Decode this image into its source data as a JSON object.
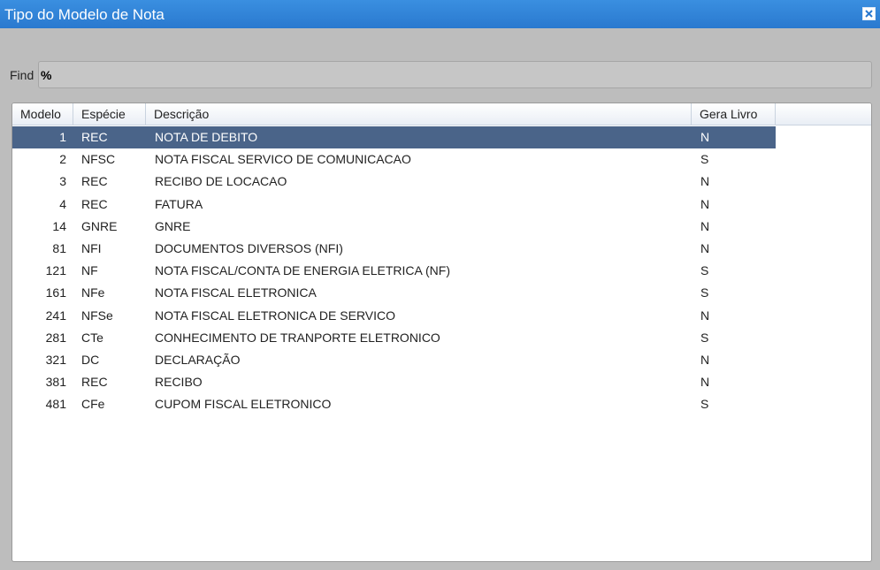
{
  "window": {
    "title": "Tipo do Modelo de Nota"
  },
  "find": {
    "label": "Find",
    "value": "%"
  },
  "table": {
    "columns": [
      "Modelo",
      "Espécie",
      "Descrição",
      "Gera Livro"
    ],
    "selected_row": 0,
    "rows": [
      {
        "modelo": "1",
        "especie": "REC",
        "descricao": "NOTA DE DEBITO",
        "gera_livro": "N"
      },
      {
        "modelo": "2",
        "especie": "NFSC",
        "descricao": "NOTA FISCAL SERVICO DE COMUNICACAO",
        "gera_livro": "S"
      },
      {
        "modelo": "3",
        "especie": "REC",
        "descricao": "RECIBO DE LOCACAO",
        "gera_livro": "N"
      },
      {
        "modelo": "4",
        "especie": "REC",
        "descricao": "FATURA",
        "gera_livro": "N"
      },
      {
        "modelo": "14",
        "especie": "GNRE",
        "descricao": "GNRE",
        "gera_livro": "N"
      },
      {
        "modelo": "81",
        "especie": "NFI",
        "descricao": "DOCUMENTOS DIVERSOS (NFI)",
        "gera_livro": "N"
      },
      {
        "modelo": "121",
        "especie": "NF",
        "descricao": "NOTA FISCAL/CONTA DE ENERGIA ELETRICA (NF)",
        "gera_livro": "S"
      },
      {
        "modelo": "161",
        "especie": "NFe",
        "descricao": "NOTA FISCAL ELETRONICA",
        "gera_livro": "S"
      },
      {
        "modelo": "241",
        "especie": "NFSe",
        "descricao": "NOTA FISCAL ELETRONICA DE SERVICO",
        "gera_livro": "N"
      },
      {
        "modelo": "281",
        "especie": "CTe",
        "descricao": "CONHECIMENTO DE TRANPORTE ELETRONICO",
        "gera_livro": "S"
      },
      {
        "modelo": "321",
        "especie": "DC",
        "descricao": "DECLARAÇÃO",
        "gera_livro": "N"
      },
      {
        "modelo": "381",
        "especie": "REC",
        "descricao": "RECIBO",
        "gera_livro": "N"
      },
      {
        "modelo": "481",
        "especie": "CFe",
        "descricao": "CUPOM FISCAL ELETRONICO",
        "gera_livro": "S"
      }
    ]
  },
  "icons": {
    "close": "close-icon"
  },
  "colors": {
    "titlebar": "#2f84d8",
    "selection": "#4a6489"
  }
}
